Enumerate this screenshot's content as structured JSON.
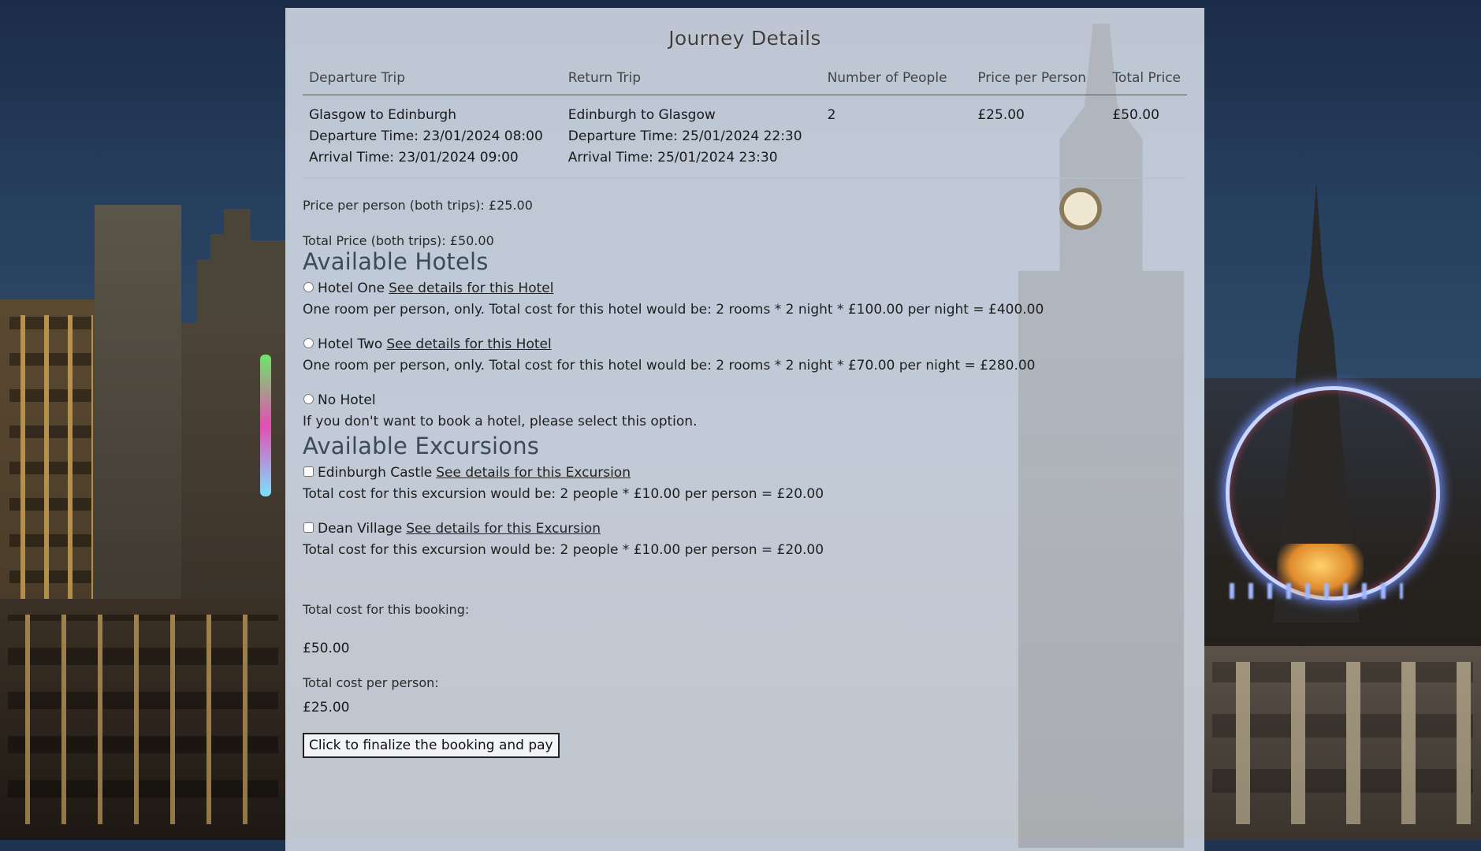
{
  "page": {
    "title": "Journey Details"
  },
  "journey_table": {
    "headers": {
      "departure": "Departure Trip",
      "return": "Return Trip",
      "people": "Number of People",
      "price_per_person": "Price per Person",
      "total_price": "Total Price"
    },
    "row": {
      "departure_route": "Glasgow to Edinburgh",
      "departure_time": "Departure Time: 23/01/2024 08:00",
      "departure_arrival": "Arrival Time: 23/01/2024 09:00",
      "return_route": "Edinburgh to Glasgow",
      "return_time": "Departure Time: 25/01/2024 22:30",
      "return_arrival": "Arrival Time: 25/01/2024 23:30",
      "people": "2",
      "price_per_person": "£25.00",
      "total_price": "£50.00"
    }
  },
  "summary": {
    "price_per_person": "Price per person (both trips): £25.00",
    "total_price": "Total Price (both trips): £50.00"
  },
  "hotels": {
    "heading": "Available Hotels",
    "details_link": "See details for this Hotel",
    "options": [
      {
        "name": "Hotel One",
        "cost_text": "One room per person, only. Total cost for this hotel would be: 2 rooms * 2 night * £100.00 per night = £400.00",
        "selected": false
      },
      {
        "name": "Hotel Two",
        "cost_text": "One room per person, only. Total cost for this hotel would be: 2 rooms * 2 night * £70.00 per night = £280.00",
        "selected": false
      },
      {
        "name": "No Hotel",
        "cost_text": "If you don't want to book a hotel, please select this option.",
        "selected": false
      }
    ]
  },
  "excursions": {
    "heading": "Available Excursions",
    "details_link": "See details for this Excursion",
    "options": [
      {
        "name": "Edinburgh Castle",
        "cost_text": "Total cost for this excursion would be: 2 people * £10.00 per person = £20.00",
        "checked": false
      },
      {
        "name": "Dean Village",
        "cost_text": "Total cost for this excursion would be: 2 people * £10.00 per person = £20.00",
        "checked": false
      }
    ]
  },
  "totals": {
    "booking_label": "Total cost for this booking:",
    "booking_value": "£50.00",
    "per_person_label": "Total cost per person:",
    "per_person_value": "£25.00"
  },
  "actions": {
    "finalize_label": "Click to finalize the booking and pay"
  }
}
